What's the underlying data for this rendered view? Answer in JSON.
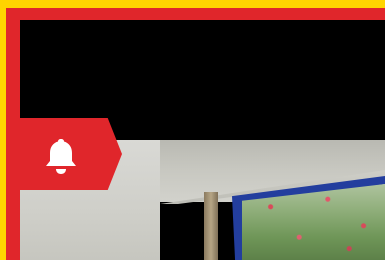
{
  "camera_feed": {
    "alert_icon": "bell-icon",
    "colors": {
      "outer_frame": "#ffd400",
      "inner_frame": "#e0262b",
      "alert_badge": "#e0262b",
      "bell": "#ffffff"
    }
  }
}
